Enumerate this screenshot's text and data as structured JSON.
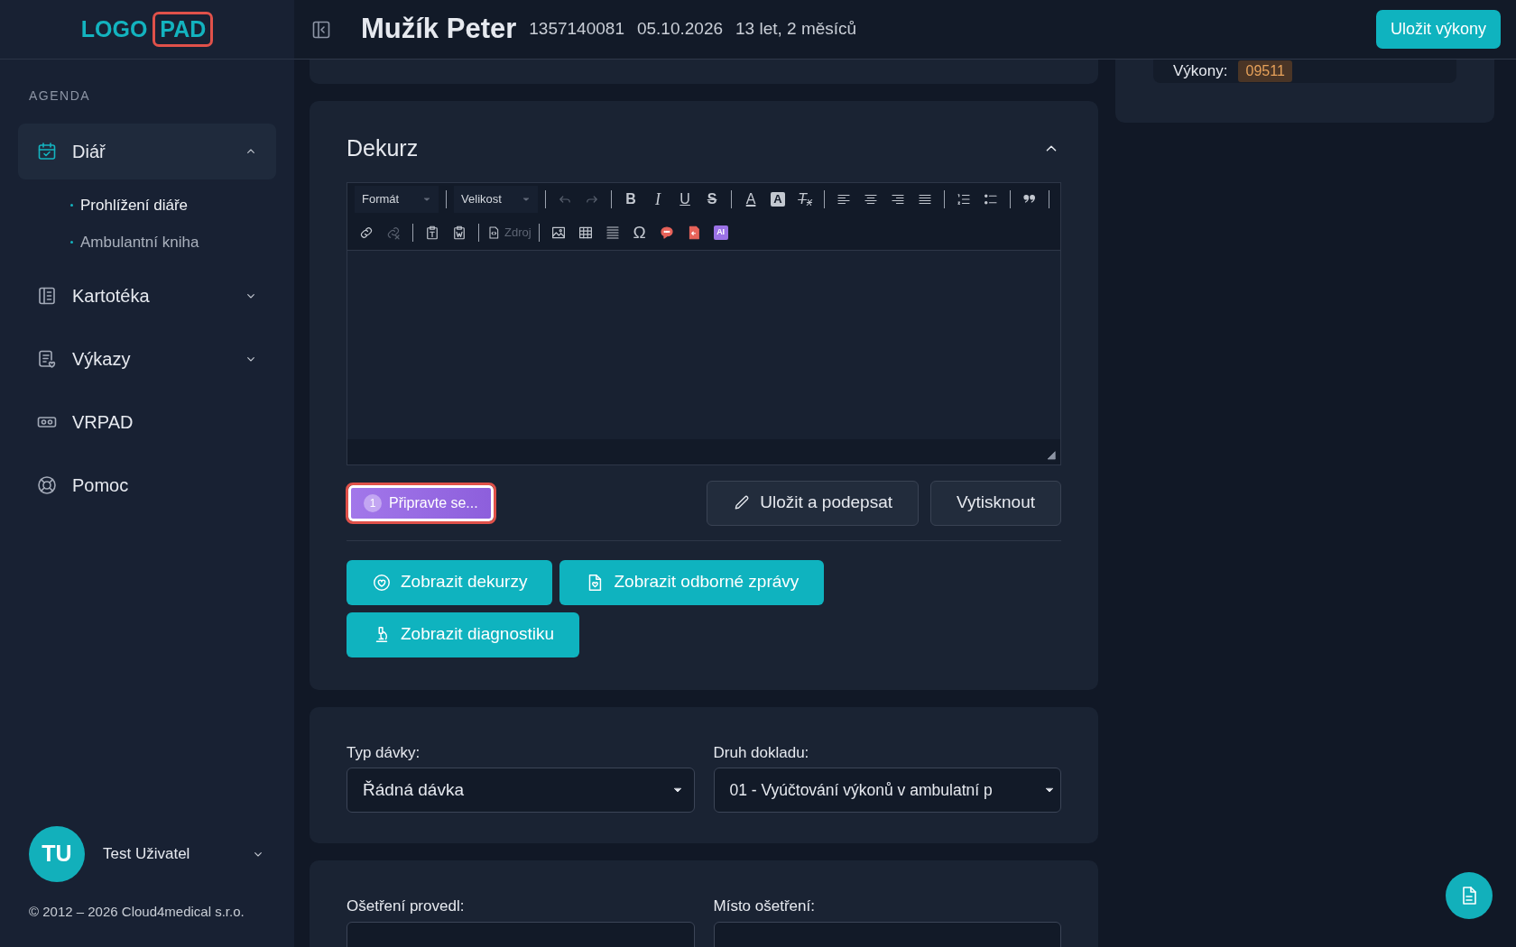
{
  "sidebar": {
    "logo": {
      "text": "LOGO",
      "boxed": "PAD"
    },
    "section": "AGENDA",
    "items": [
      {
        "label": "Diář",
        "selected": true,
        "expanded": true,
        "children": [
          {
            "label": "Prohlížení diáře",
            "selected": true
          },
          {
            "label": "Ambulantní kniha",
            "selected": false
          }
        ]
      },
      {
        "label": "Kartotéka",
        "selected": false,
        "expanded": false
      },
      {
        "label": "Výkazy",
        "selected": false,
        "expanded": false
      },
      {
        "label": "VRPAD",
        "selected": false
      },
      {
        "label": "Pomoc",
        "selected": false
      }
    ],
    "user": {
      "initials": "TU",
      "name": "Test Uživatel"
    },
    "copyright": "© 2012 – 2026 Cloud4medical s.r.o."
  },
  "header": {
    "patient": "Mužík Peter",
    "id": "1357140081",
    "date": "05.10.2026",
    "age": "13 let, 2 měsíců",
    "button": "Uložit výkony"
  },
  "summary": {
    "label": "Výkony:",
    "badge": "09511"
  },
  "dekurz": {
    "title": "Dekurz",
    "expanded": true,
    "toolbar": {
      "format": "Formát",
      "size": "Velikost",
      "glyphs": [
        "B",
        "I",
        "U",
        "S",
        "A",
        "A",
        "T$_{x}$",
        "Ω",
        "AI"
      ],
      "source": {
        "label": "Zdroj",
        "disabled": true
      }
    },
    "actions": [
      {
        "label": "Připravte se...",
        "count": "1",
        "kind": "assistant"
      },
      {
        "label": "Uložit a podepsat",
        "kind": "sign"
      },
      {
        "label": "Vytisknout",
        "kind": "plain"
      }
    ],
    "links": [
      {
        "label": "Zobrazit dekurzy"
      },
      {
        "label": "Zobrazit odborné zprávy"
      },
      {
        "label": "Zobrazit diagnostiku"
      }
    ]
  },
  "batch": {
    "fields": [
      {
        "label": "Typ dávky:",
        "value": "Řádná dávka"
      },
      {
        "label": "Druh dokladu:",
        "value": "01 - Vyúčtování výkonů v ambulatní p"
      }
    ]
  },
  "treatment": {
    "fields": [
      {
        "label": "Ošetření provedl:"
      },
      {
        "label": "Místo ošetření:"
      }
    ]
  }
}
